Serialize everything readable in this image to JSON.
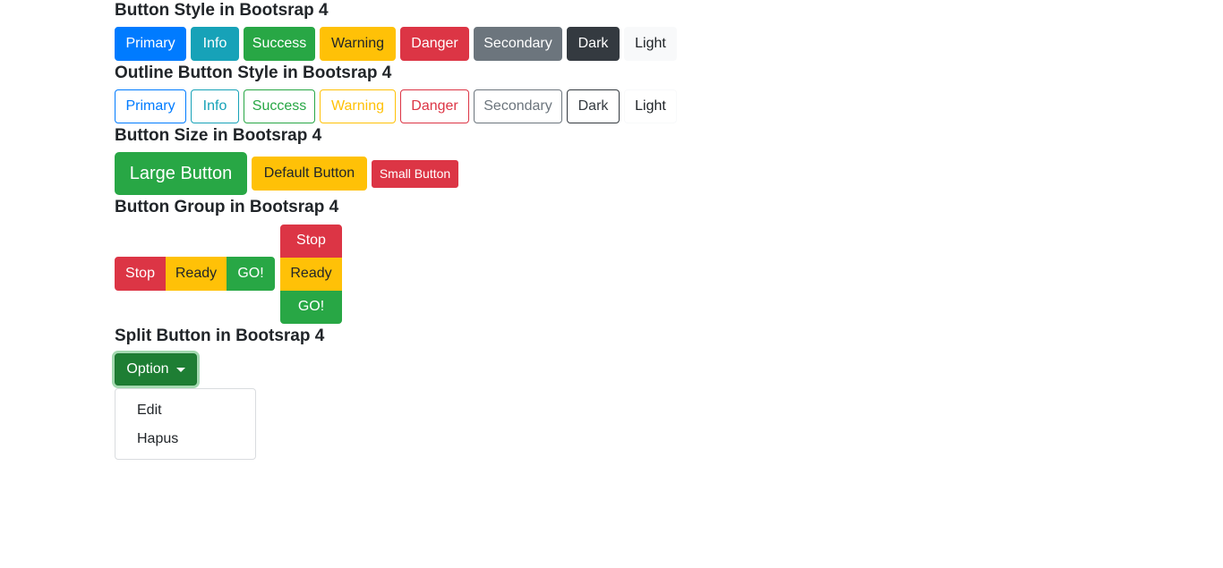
{
  "sections": {
    "style": {
      "title": "Button Style in Bootsrap 4",
      "buttons": [
        "Primary",
        "Info",
        "Success",
        "Warning",
        "Danger",
        "Secondary",
        "Dark",
        "Light"
      ]
    },
    "outline": {
      "title": "Outline Button Style in Bootsrap 4",
      "buttons": [
        "Primary",
        "Info",
        "Success",
        "Warning",
        "Danger",
        "Secondary",
        "Dark",
        "Light"
      ]
    },
    "size": {
      "title": "Button Size in Bootsrap 4",
      "large": "Large Button",
      "default": "Default Button",
      "small": "Small Button"
    },
    "group": {
      "title": "Button Group in Bootsrap 4",
      "horizontal": [
        "Stop",
        "Ready",
        "GO!"
      ],
      "vertical": [
        "Stop",
        "Ready",
        "GO!"
      ]
    },
    "split": {
      "title": "Split Button in Bootsrap 4",
      "button": "Option",
      "menu": [
        "Edit",
        "Hapus"
      ]
    }
  },
  "colors": {
    "primary": "#007bff",
    "info": "#17a2b8",
    "success": "#28a745",
    "warning": "#ffc107",
    "danger": "#dc3545",
    "secondary": "#6c757d",
    "dark": "#343a40",
    "light": "#f8f9fa"
  }
}
